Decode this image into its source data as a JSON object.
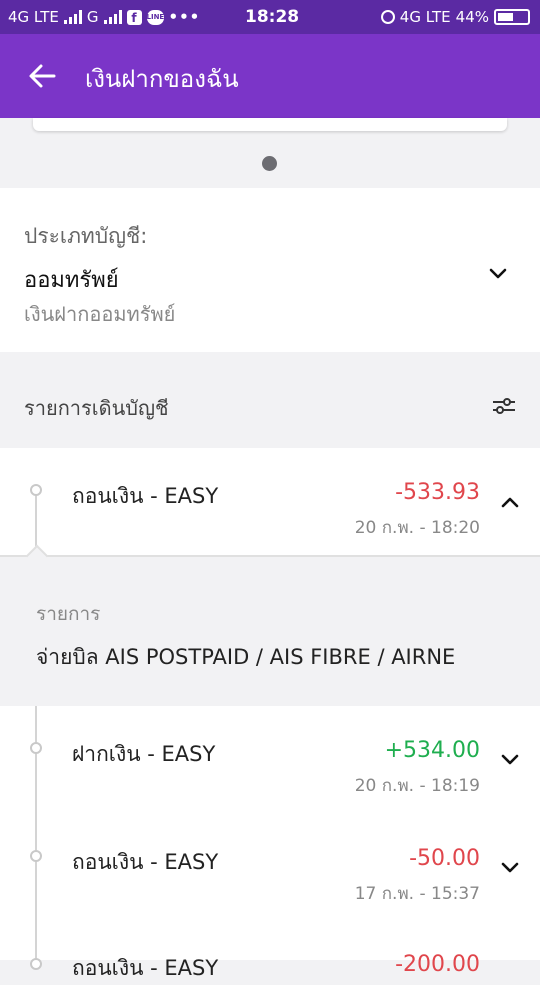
{
  "status_bar": {
    "left_network_1": "4G LTE",
    "left_network_2": "G",
    "time": "18:28",
    "right_network": "4G LTE",
    "battery_percent": "44%"
  },
  "app_bar": {
    "title": "เงินฝากของฉัน"
  },
  "account": {
    "type_label": "ประเภทบัญชี:",
    "type_value": "ออมทรัพย์",
    "type_subtitle": "เงินฝากออมทรัพย์"
  },
  "statement": {
    "header": "รายการเดินบัญชี"
  },
  "transactions": [
    {
      "name": "ถอนเงิน  - EASY",
      "amount": "-533.93",
      "date": "20 ก.พ. - 18:20",
      "expanded": true
    },
    {
      "name": "ฝากเงิน  - EASY",
      "amount": "+534.00",
      "date": "20 ก.พ. - 18:19",
      "expanded": false
    },
    {
      "name": "ถอนเงิน  - EASY",
      "amount": "-50.00",
      "date": "17 ก.พ. - 15:37",
      "expanded": false
    },
    {
      "name": "ถอนเงิน  - EASY",
      "amount": "-200.00",
      "date": "",
      "expanded": false
    }
  ],
  "detail": {
    "label": "รายการ",
    "value": "จ่ายบิล AIS POSTPAID / AIS FIBRE / AIRNE"
  },
  "colors": {
    "status_bar": "#5b2aa3",
    "app_bar": "#7b35c8",
    "negative": "#e0464c",
    "positive": "#1fae4f"
  }
}
